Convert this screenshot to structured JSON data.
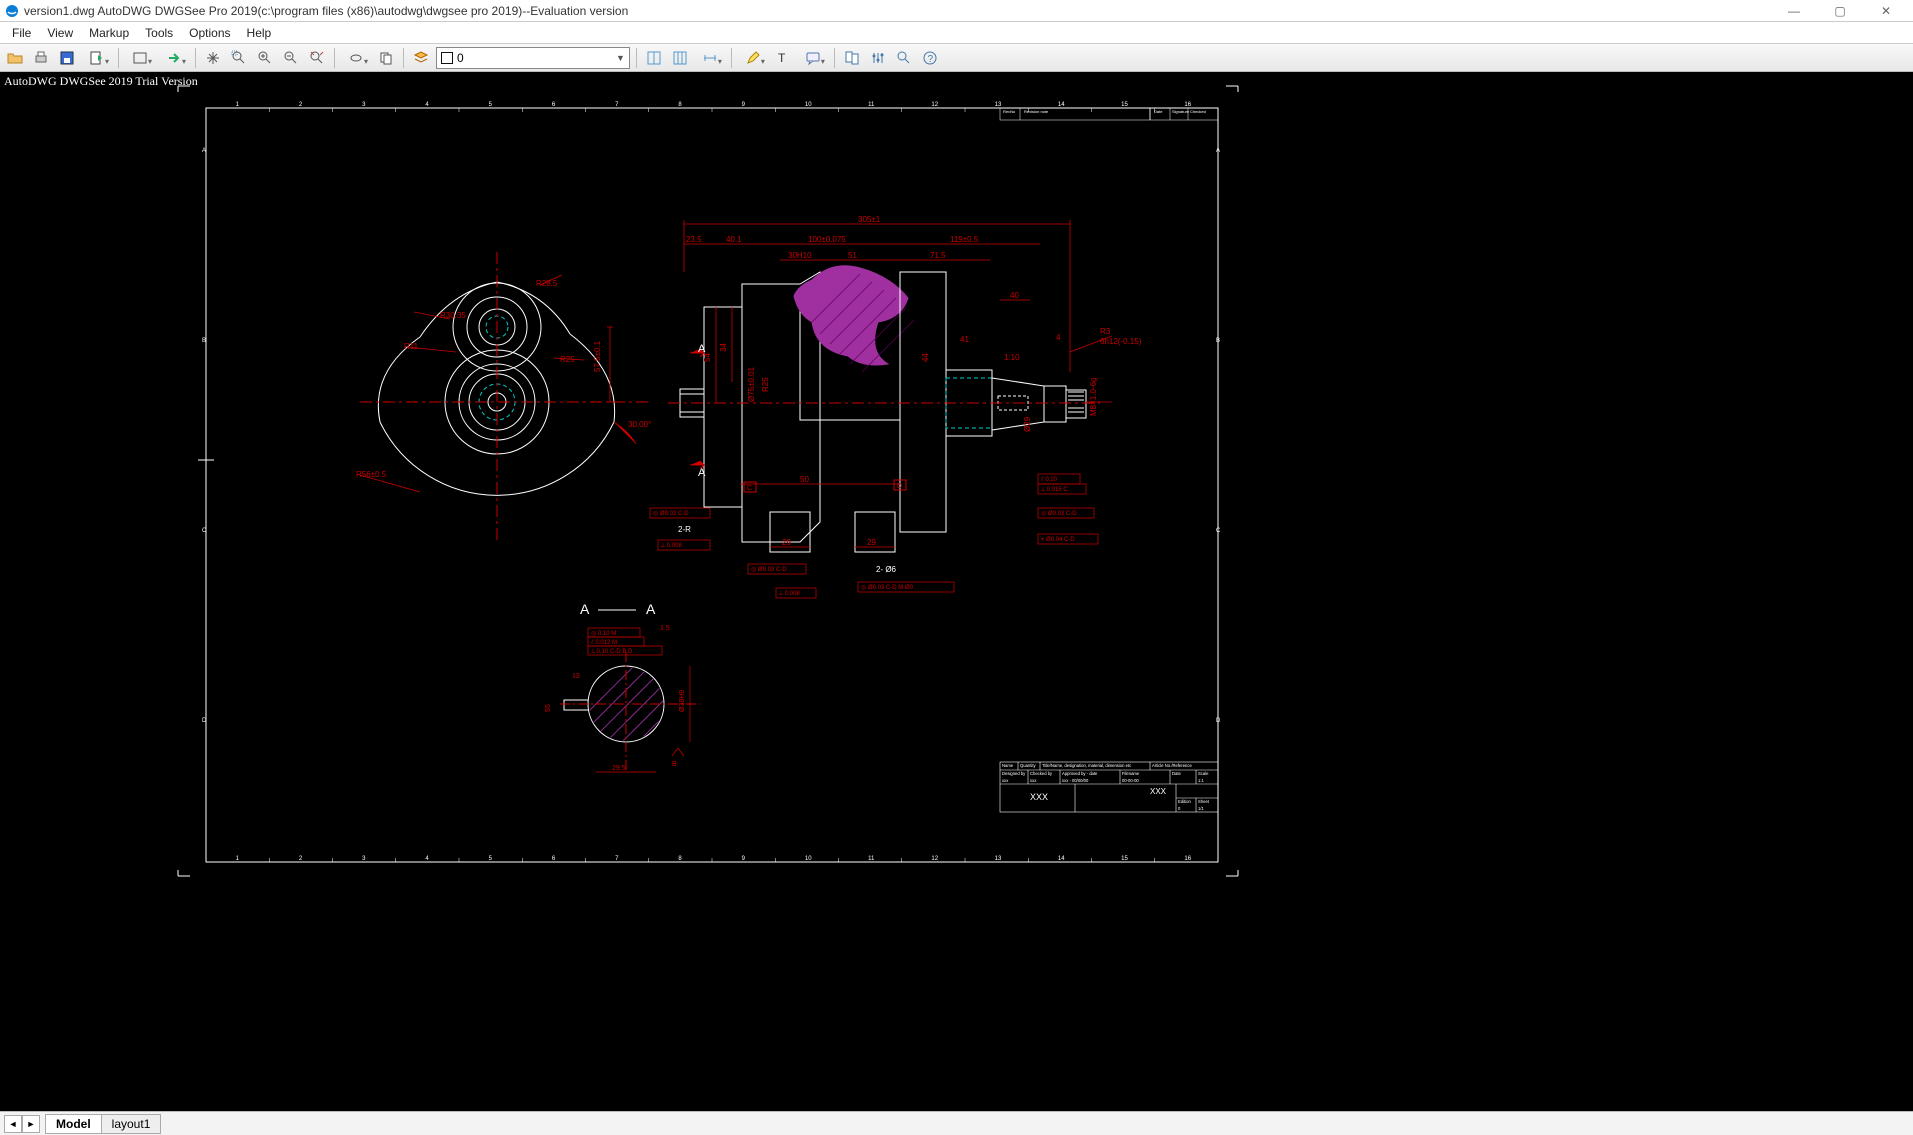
{
  "window": {
    "title": "version1.dwg AutoDWG DWGSee Pro 2019(c:\\program files (x86)\\autodwg\\dwgsee pro 2019)--Evaluation version"
  },
  "menu": {
    "file": "File",
    "view": "View",
    "markup": "Markup",
    "tools": "Tools",
    "options": "Options",
    "help": "Help"
  },
  "toolbar": {
    "layer_value": "0"
  },
  "canvas": {
    "trial_text": "AutoDWG DWGSee 2019 Trial Version"
  },
  "ruler": {
    "ticks": [
      "1",
      "2",
      "3",
      "4",
      "5",
      "6",
      "7",
      "8",
      "9",
      "10",
      "11",
      "12",
      "13",
      "14",
      "15",
      "16"
    ]
  },
  "tabs": {
    "model": "Model",
    "layout1": "layout1"
  },
  "titleblock": {
    "name": "Name",
    "quantity": "Quantity",
    "title_desc": "Title/Name, designation, material, dimension etc",
    "article_no": "Article No./Reference",
    "designed_by": "Designed by",
    "checked_by": "Checked by",
    "approved_by_date": "Approved by - date",
    "filename": "Filename",
    "date": "Date",
    "scale": "Scale",
    "checked_by_val": "xxx",
    "approved_val": "xxx - 00/00/00",
    "filename_val": "00-00-00",
    "scale_val": "1:1",
    "main_xxx_left": "XXX",
    "main_xxx_right": "XXX",
    "edition": "Edition",
    "sheet": "Sheet",
    "edition_val": "0",
    "sheet_val": "1/1"
  },
  "revblock": {
    "revno": "RevNo",
    "revnote": "Revision note",
    "date": "Date",
    "sig": "Signature",
    "checked": "Checked"
  },
  "dims": {
    "overall": "305±1",
    "d1": "23.5",
    "d2": "40.1",
    "d3": "100±0.075",
    "d4": "119±0.5",
    "d5": "30H10",
    "d6": "51",
    "d7": "71.5",
    "d8": "26",
    "d9": "44",
    "d10": "41",
    "d11": "54",
    "d12": "34",
    "d13": "40",
    "d14": "1:10",
    "d15": "29",
    "d16": "29",
    "d17": "50",
    "d18": "R28.5",
    "d19": "R30.35",
    "d20": "R11",
    "d21": "R12",
    "d22": "R25",
    "d23": "57.5±0.1",
    "d24": "30.00°",
    "d25": "R56±0.5",
    "section_aa": "A — A",
    "d26": "29.5",
    "d27": "13",
    "d28": "1.5",
    "d29": "Ø38H9",
    "d30": "4",
    "d31": "55",
    "d32": "Ø75±0.01",
    "d33": "R25",
    "d34": "20",
    "d35": "Ø29",
    "d36": "M8×1.0-6g",
    "d37": "R3",
    "d38": "6h12(-0.15)",
    "note1": "2- Ø6",
    "note2": "2-R"
  },
  "fcf": {
    "f1": "◎ Ø0.02 C-D",
    "f2": "⟂ 0.008",
    "f3": "◎ Ø0.03 C-D",
    "f4": "⟂ 0.008",
    "f5": "◎ Ø0.03 C-D M Ø0",
    "f6": "⫽ 0.20",
    "f7": "⟂ 0.015 C",
    "f8": "◎ Ø0.03 C-D",
    "f9": "⌖ Ø0.04 C-D",
    "f10": "◎ 0.10 M",
    "f11": "⫽ 0.012 M",
    "f12": "⟂ 0.10 C-D B D"
  },
  "datum": {
    "a1": "A",
    "a2": "A",
    "c": "C",
    "d": "D"
  }
}
